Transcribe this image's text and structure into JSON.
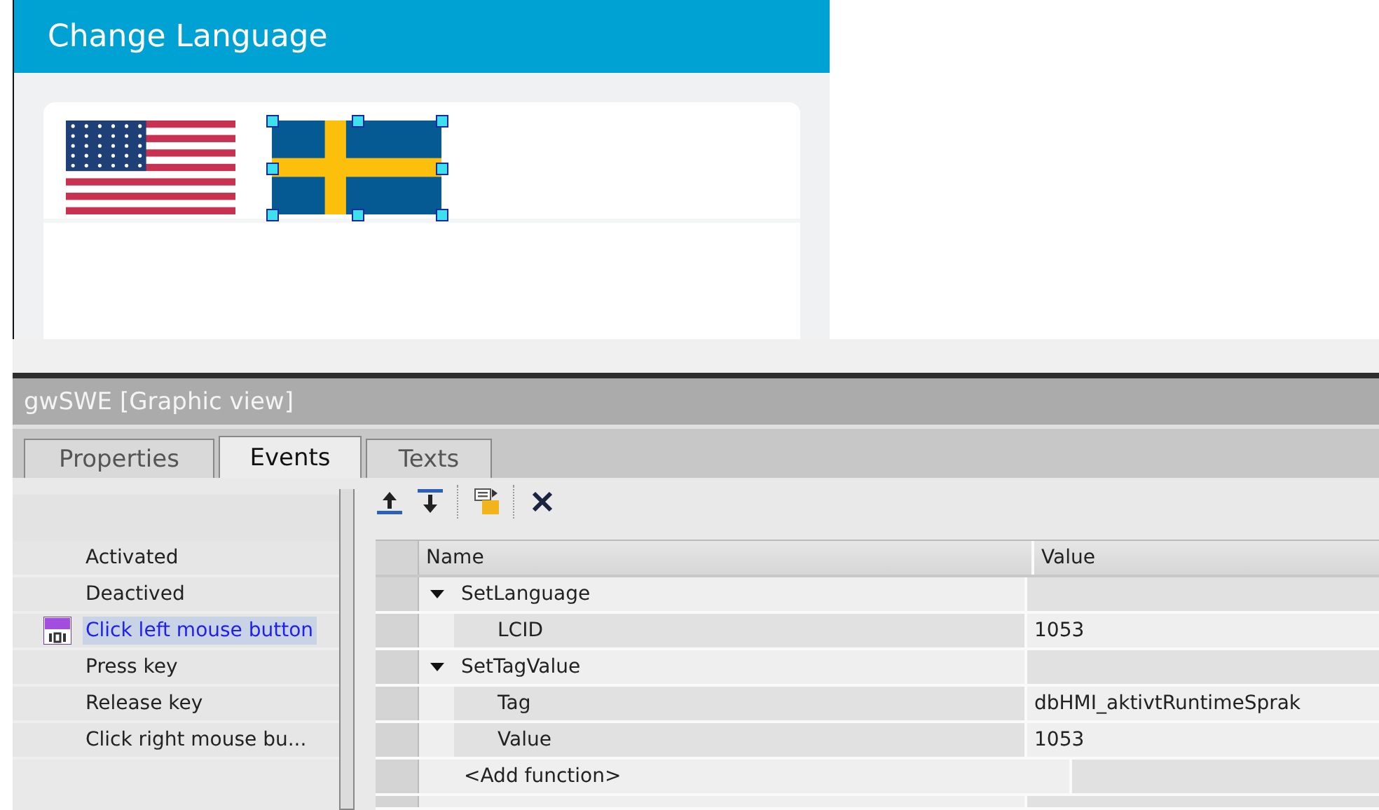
{
  "screen": {
    "title": "Change Language",
    "flags": [
      {
        "kind": "us",
        "selected": false
      },
      {
        "kind": "se",
        "selected": true
      }
    ]
  },
  "inspector": {
    "title": "gwSWE [Graphic view]",
    "tabs": [
      {
        "label": "Properties",
        "selected": false
      },
      {
        "label": "Events",
        "selected": true
      },
      {
        "label": "Texts",
        "selected": false
      }
    ],
    "events": [
      {
        "label": "Activated",
        "selected": false
      },
      {
        "label": "Deactived",
        "selected": false
      },
      {
        "label": "Click left mouse button",
        "selected": true
      },
      {
        "label": "Press key",
        "selected": false
      },
      {
        "label": "Release key",
        "selected": false
      },
      {
        "label": "Click right mouse bu...",
        "selected": false
      }
    ],
    "table": {
      "columns": [
        "Name",
        "Value"
      ],
      "rows": [
        {
          "kind": "function",
          "name": "SetLanguage",
          "expanded": true
        },
        {
          "kind": "param",
          "name": "LCID",
          "value": "1053"
        },
        {
          "kind": "function",
          "name": "SetTagValue",
          "expanded": true
        },
        {
          "kind": "param",
          "name": "Tag",
          "value": "dbHMI_aktivtRuntimeSprak"
        },
        {
          "kind": "param",
          "name": "Value",
          "value": "1053"
        },
        {
          "kind": "add",
          "name": "<Add function>"
        }
      ]
    }
  }
}
